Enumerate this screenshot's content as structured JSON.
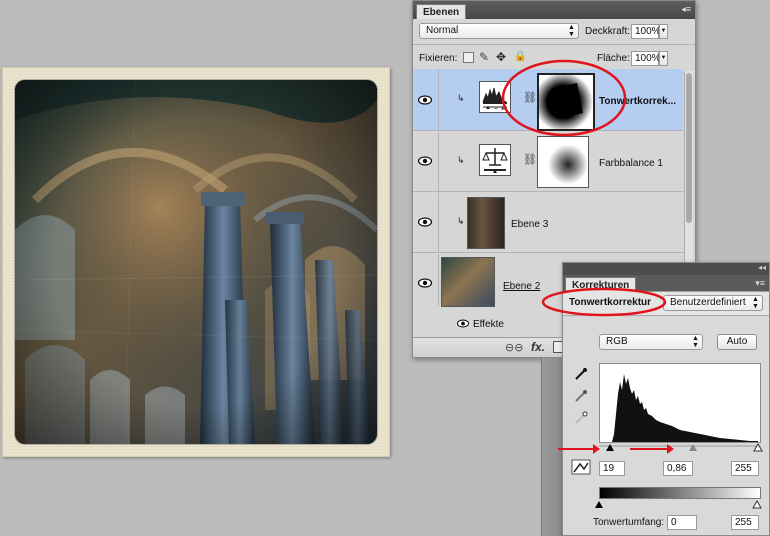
{
  "layers_panel": {
    "tab": "Ebenen",
    "blend_mode": "Normal",
    "opacity_label": "Deckkraft:",
    "opacity_value": "100%",
    "lock_label": "Fixieren:",
    "fill_label": "Fläche:",
    "fill_value": "100%",
    "layers": [
      {
        "name": "Tonwertkorrek...",
        "selected": true
      },
      {
        "name": "Farbbalance 1",
        "selected": false
      },
      {
        "name": "Ebene 3",
        "selected": false
      },
      {
        "name": "Ebene 2",
        "selected": false
      }
    ],
    "effects_label": "Effekte",
    "fx_label": "fx."
  },
  "corrections_panel": {
    "tab": "Korrekturen",
    "adjustment_title": "Tonwertkorrektur",
    "preset": "Benutzerdefiniert",
    "channel": "RGB",
    "auto_button": "Auto",
    "input_black": "19",
    "input_gamma": "0,86",
    "input_white": "255",
    "output_label": "Tonwertumfang:",
    "output_black": "0",
    "output_white": "255"
  },
  "colors": {
    "annotation_red": "#e0141c",
    "selection_blue": "#b6cdf2"
  }
}
